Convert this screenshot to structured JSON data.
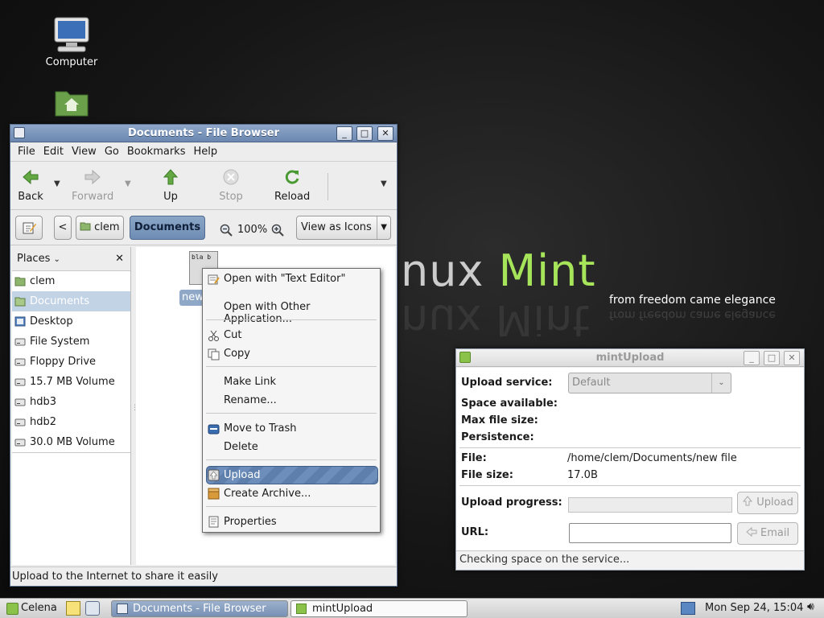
{
  "desktop": {
    "icons": [
      {
        "label": "Computer"
      }
    ],
    "brand_left": "nux ",
    "brand_right": "Mint",
    "tagline": "from freedom came elegance"
  },
  "file_browser": {
    "title": "Documents - File Browser",
    "menu": [
      "File",
      "Edit",
      "View",
      "Go",
      "Bookmarks",
      "Help"
    ],
    "toolbar": {
      "back": "Back",
      "forward": "Forward",
      "up": "Up",
      "stop": "Stop",
      "reload": "Reload"
    },
    "location": {
      "parent": "clem",
      "current": "Documents",
      "zoom": "100%",
      "view_mode": "View as Icons"
    },
    "places": {
      "header": "Places",
      "items": [
        "clem",
        "Documents",
        "Desktop",
        "File System",
        "Floppy Drive",
        "15.7 MB Volume",
        "hdb3",
        "hdb2",
        "30.0 MB Volume"
      ],
      "selected": "Documents"
    },
    "file": {
      "label": "new",
      "thumb_text": "bla b"
    },
    "status": "Upload to the Internet to share it easily"
  },
  "context_menu": {
    "items": [
      {
        "label": "Open with \"Text Editor\""
      },
      {
        "label": "Open with Other Application..."
      },
      {
        "label": "Cut"
      },
      {
        "label": "Copy"
      },
      {
        "label": "Make Link"
      },
      {
        "label": "Rename..."
      },
      {
        "label": "Move to Trash"
      },
      {
        "label": "Delete"
      },
      {
        "label": "Upload"
      },
      {
        "label": "Create Archive..."
      },
      {
        "label": "Properties"
      }
    ],
    "highlighted": "Upload"
  },
  "mintupload": {
    "title": "mintUpload",
    "upload_service_label": "Upload service:",
    "upload_service_value": "Default",
    "space_available_label": "Space available:",
    "max_file_size_label": "Max file size:",
    "persistence_label": "Persistence:",
    "file_label": "File:",
    "file_value": "/home/clem/Documents/new file",
    "file_size_label": "File size:",
    "file_size_value": "17.0B",
    "upload_progress_label": "Upload progress:",
    "upload_progress": 0,
    "upload_button": "Upload",
    "url_label": "URL:",
    "url_value": "",
    "email_button": "Email",
    "status": "Checking space on the service..."
  },
  "taskbar": {
    "menu_label": "Celena",
    "tasks": [
      {
        "label": "Documents - File Browser",
        "active": true
      },
      {
        "label": "mintUpload",
        "active": false
      }
    ],
    "clock": "Mon Sep 24, 15:04"
  }
}
